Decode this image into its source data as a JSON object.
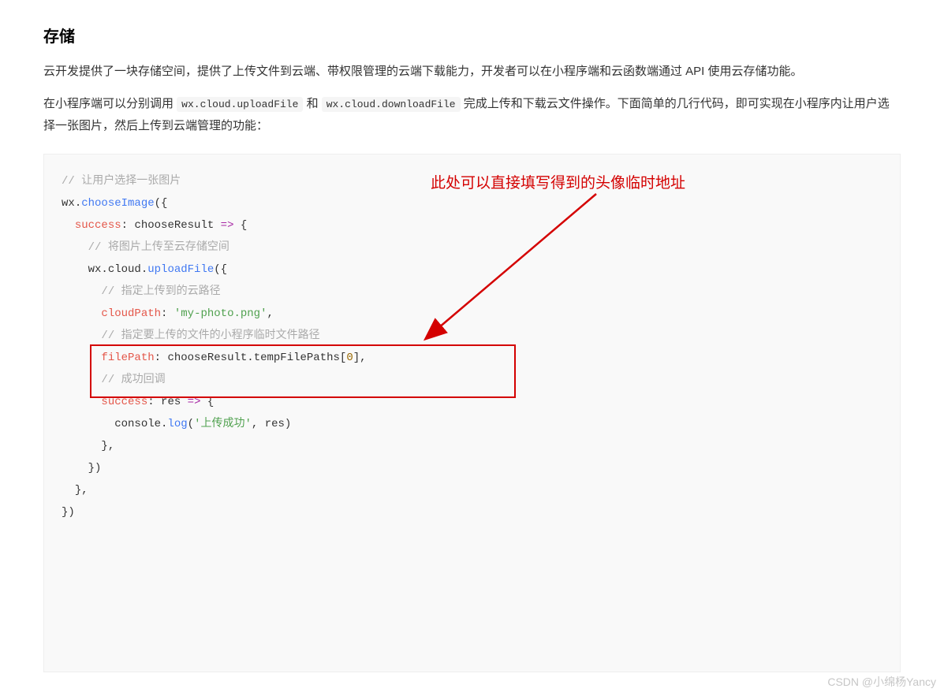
{
  "title": "存储",
  "para1": "云开发提供了一块存储空间，提供了上传文件到云端、带权限管理的云端下载能力，开发者可以在小程序端和云函数端通过 API 使用云存储功能。",
  "para2_a": "在小程序端可以分别调用 ",
  "para2_code1": "wx.cloud.uploadFile",
  "para2_b": " 和 ",
  "para2_code2": "wx.cloud.downloadFile",
  "para2_c": " 完成上传和下载云文件操作。下面简单的几行代码，即可实现在小程序内让用户选择一张图片，然后上传到云端管理的功能：",
  "annotation": "此处可以直接填写得到的头像临时地址",
  "watermark": "CSDN @小绵杨Yancy",
  "code": {
    "c1": "// 让用户选择一张图片",
    "l2_wx": "wx",
    "l2_fn": "chooseImage",
    "l3_key": "success",
    "l3_arg": "chooseResult",
    "c2": "// 将图片上传至云存储空间",
    "l5_wx": "wx",
    "l5_cloud": "cloud",
    "l5_fn": "uploadFile",
    "c3": "// 指定上传到的云路径",
    "l7_key": "cloudPath",
    "l7_str": "'my-photo.png'",
    "c4": "// 指定要上传的文件的小程序临时文件路径",
    "l9_key": "filePath",
    "l9_obj": "chooseResult",
    "l9_prop": "tempFilePaths",
    "l9_idx": "0",
    "c5": "// 成功回调",
    "l11_key": "success",
    "l11_arg": "res",
    "l12_obj": "console",
    "l12_fn": "log",
    "l12_str": "'上传成功'",
    "l12_arg": "res"
  }
}
